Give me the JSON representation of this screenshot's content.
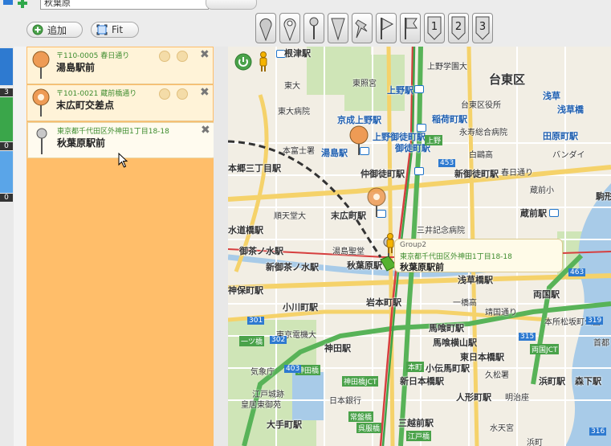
{
  "toolbar": {
    "search_value": "秋葉原",
    "add_label": "追加",
    "fit_label": "Fit"
  },
  "marker_tools": [
    {
      "name": "marker-pin-round",
      "label": ""
    },
    {
      "name": "marker-pin-outline",
      "label": ""
    },
    {
      "name": "marker-pin-needle",
      "label": ""
    },
    {
      "name": "marker-pin-triangle",
      "label": ""
    },
    {
      "name": "marker-pushpin",
      "label": ""
    },
    {
      "name": "marker-flag-triangle",
      "label": ""
    },
    {
      "name": "marker-flag",
      "label": ""
    },
    {
      "name": "marker-number-1",
      "label": "1"
    },
    {
      "name": "marker-number-2",
      "label": "2"
    },
    {
      "name": "marker-number-3",
      "label": "3"
    }
  ],
  "left_strip": {
    "counts": [
      "3",
      "0",
      "0"
    ],
    "colors": [
      "#2e7ad0",
      "#3aa64a",
      "#5aa5e8"
    ]
  },
  "list": {
    "items": [
      {
        "address": "〒110-0005 春日通り",
        "name": "湯島駅前",
        "pin_color": "#ee9b55"
      },
      {
        "address": "〒101-0021 蔵前橋通り",
        "name": "末広町交差点",
        "pin_color": "#ee9b55"
      },
      {
        "address": "東京都千代田区外神田1丁目18-18",
        "name": "秋葉原駅前",
        "pin_color": "#999999"
      }
    ]
  },
  "popup": {
    "group": "Group2",
    "address": "東京都千代田区外神田1丁目18-18",
    "name": "秋葉原駅前"
  },
  "map": {
    "ward": "台東区",
    "labels": [
      {
        "text": "根津駅"
      },
      {
        "text": "上野学園大"
      },
      {
        "text": "東大"
      },
      {
        "text": "東照宮"
      },
      {
        "text": "上野駅"
      },
      {
        "text": "浅草"
      },
      {
        "text": "東大病院"
      },
      {
        "text": "台東区役所"
      },
      {
        "text": "浅草橋"
      },
      {
        "text": "京成上野駅"
      },
      {
        "text": "稲荷町駅"
      },
      {
        "text": "上野御徒町駅"
      },
      {
        "text": "永寿総合病院"
      },
      {
        "text": "田原町駅"
      },
      {
        "text": "本富士署"
      },
      {
        "text": "湯島駅"
      },
      {
        "text": "御徒町駅"
      },
      {
        "text": "上野"
      },
      {
        "text": "白鷗高"
      },
      {
        "text": "バンダイ"
      },
      {
        "text": "本郷三丁目駅"
      },
      {
        "text": "仲御徒町駅"
      },
      {
        "text": "新御徒町駅"
      },
      {
        "text": "春日通り"
      },
      {
        "text": "蔵前小"
      },
      {
        "text": "駒形"
      },
      {
        "text": "順天堂大"
      },
      {
        "text": "末広町駅"
      },
      {
        "text": "蔵前駅"
      },
      {
        "text": "水道橋駅"
      },
      {
        "text": "三井記念病院"
      },
      {
        "text": "御茶ノ水駅"
      },
      {
        "text": "新御茶ノ水駅"
      },
      {
        "text": "湯島聖堂"
      },
      {
        "text": "秋葉原駅"
      },
      {
        "text": "浅草橋駅"
      },
      {
        "text": "両国駅"
      },
      {
        "text": "神保町駅"
      },
      {
        "text": "小川町駅"
      },
      {
        "text": "岩本町駅"
      },
      {
        "text": "一橋高"
      },
      {
        "text": "靖国通り"
      },
      {
        "text": "本所松坂町公園"
      },
      {
        "text": "東京電機大"
      },
      {
        "text": "馬喰町駅"
      },
      {
        "text": "馬喰横山駅"
      },
      {
        "text": "一ツ橋"
      },
      {
        "text": "神田駅"
      },
      {
        "text": "東日本橋駅"
      },
      {
        "text": "両国JCT"
      },
      {
        "text": "首都"
      },
      {
        "text": "気象庁"
      },
      {
        "text": "神田橋"
      },
      {
        "text": "小伝馬町駅"
      },
      {
        "text": "久松署"
      },
      {
        "text": "浜町駅"
      },
      {
        "text": "森下駅"
      },
      {
        "text": "神田橋JCT"
      },
      {
        "text": "新日本橋駅"
      },
      {
        "text": "本町"
      },
      {
        "text": "江戸城跡"
      },
      {
        "text": "皇居東御苑"
      },
      {
        "text": "日本銀行"
      },
      {
        "text": "人形町駅"
      },
      {
        "text": "明治座"
      },
      {
        "text": "常盤橋"
      },
      {
        "text": "呉服橋"
      },
      {
        "text": "大手町駅"
      },
      {
        "text": "三越前駅"
      },
      {
        "text": "水天宮"
      },
      {
        "text": "江戸橋"
      },
      {
        "text": "浜町"
      }
    ],
    "route_numbers": [
      "453",
      "301",
      "302",
      "315",
      "319",
      "316",
      "463",
      "403"
    ]
  }
}
